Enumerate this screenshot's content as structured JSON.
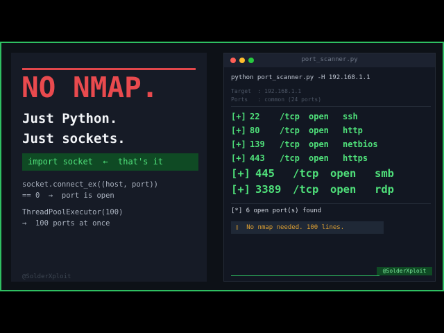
{
  "left": {
    "headline": "NO NMAP.",
    "line1": "Just Python.",
    "line2": "Just sockets.",
    "code_hint": "import socket  ←  that's it",
    "notes": [
      "socket.connect_ex((host, port))",
      "== 0  →  port is open",
      "ThreadPoolExecutor(100)",
      "→  100 ports at once"
    ],
    "watermark": "@SolderXploit"
  },
  "terminal": {
    "title": "port_scanner.py",
    "command": "python port_scanner.py -H 192.168.1.1",
    "target": "Target  : 192.168.1.1",
    "ports": "Ports   : common (24 ports)",
    "results": [
      {
        "prefix": "[+]",
        "port": "22",
        "proto": "/tcp",
        "state": "open",
        "service": "ssh"
      },
      {
        "prefix": "[+]",
        "port": "80",
        "proto": "/tcp",
        "state": "open",
        "service": "http"
      },
      {
        "prefix": "[+]",
        "port": "139",
        "proto": "/tcp",
        "state": "open",
        "service": "netbios"
      },
      {
        "prefix": "[+]",
        "port": "443",
        "proto": "/tcp",
        "state": "open",
        "service": "https"
      },
      {
        "prefix": "[+]",
        "port": "445",
        "proto": "/tcp",
        "state": "open",
        "service": "smb"
      },
      {
        "prefix": "[+]",
        "port": "3389",
        "proto": "/tcp",
        "state": "open",
        "service": "rdp"
      }
    ],
    "summary": "[*] 6 open port(s) found",
    "message_icon": "lightbulb-icon",
    "message_glyph": "▯",
    "message": "No nmap needed. 100 lines.",
    "badge": "@SolderXploit"
  },
  "colors": {
    "accent_green": "#2fbf62",
    "headline_red": "#e94a4e",
    "terminal_green": "#4fe07a",
    "message_amber": "#e0a132"
  }
}
